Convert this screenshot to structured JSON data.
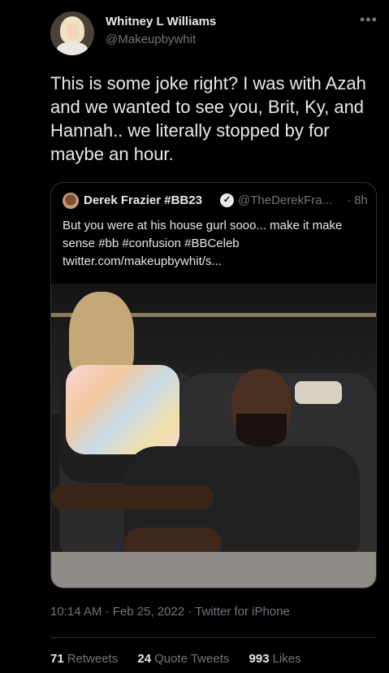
{
  "tweet": {
    "author_name": "Whitney L Williams",
    "author_handle": "@Makeupbywhit",
    "text": "This is some joke right? I was with Azah and we wanted to see you, Brit, Ky, and Hannah.. we literally stopped by for maybe an hour.",
    "more_icon": "•••",
    "timestamp": "10:14 AM · Feb 25, 2022 · Twitter for iPhone"
  },
  "quote": {
    "author_name": "Derek Frazier #BB23",
    "verified_icon": "✓",
    "author_handle": "@TheDerekFra...",
    "time": "· 8h",
    "text": "But you were at his house gurl sooo... make it make sense #bb #confusion #BBCeleb twitter.com/makeupbywhit/s..."
  },
  "stats": {
    "retweets_count": "71",
    "retweets_label": "Retweets",
    "quotes_count": "24",
    "quotes_label": "Quote Tweets",
    "likes_count": "993",
    "likes_label": "Likes"
  }
}
